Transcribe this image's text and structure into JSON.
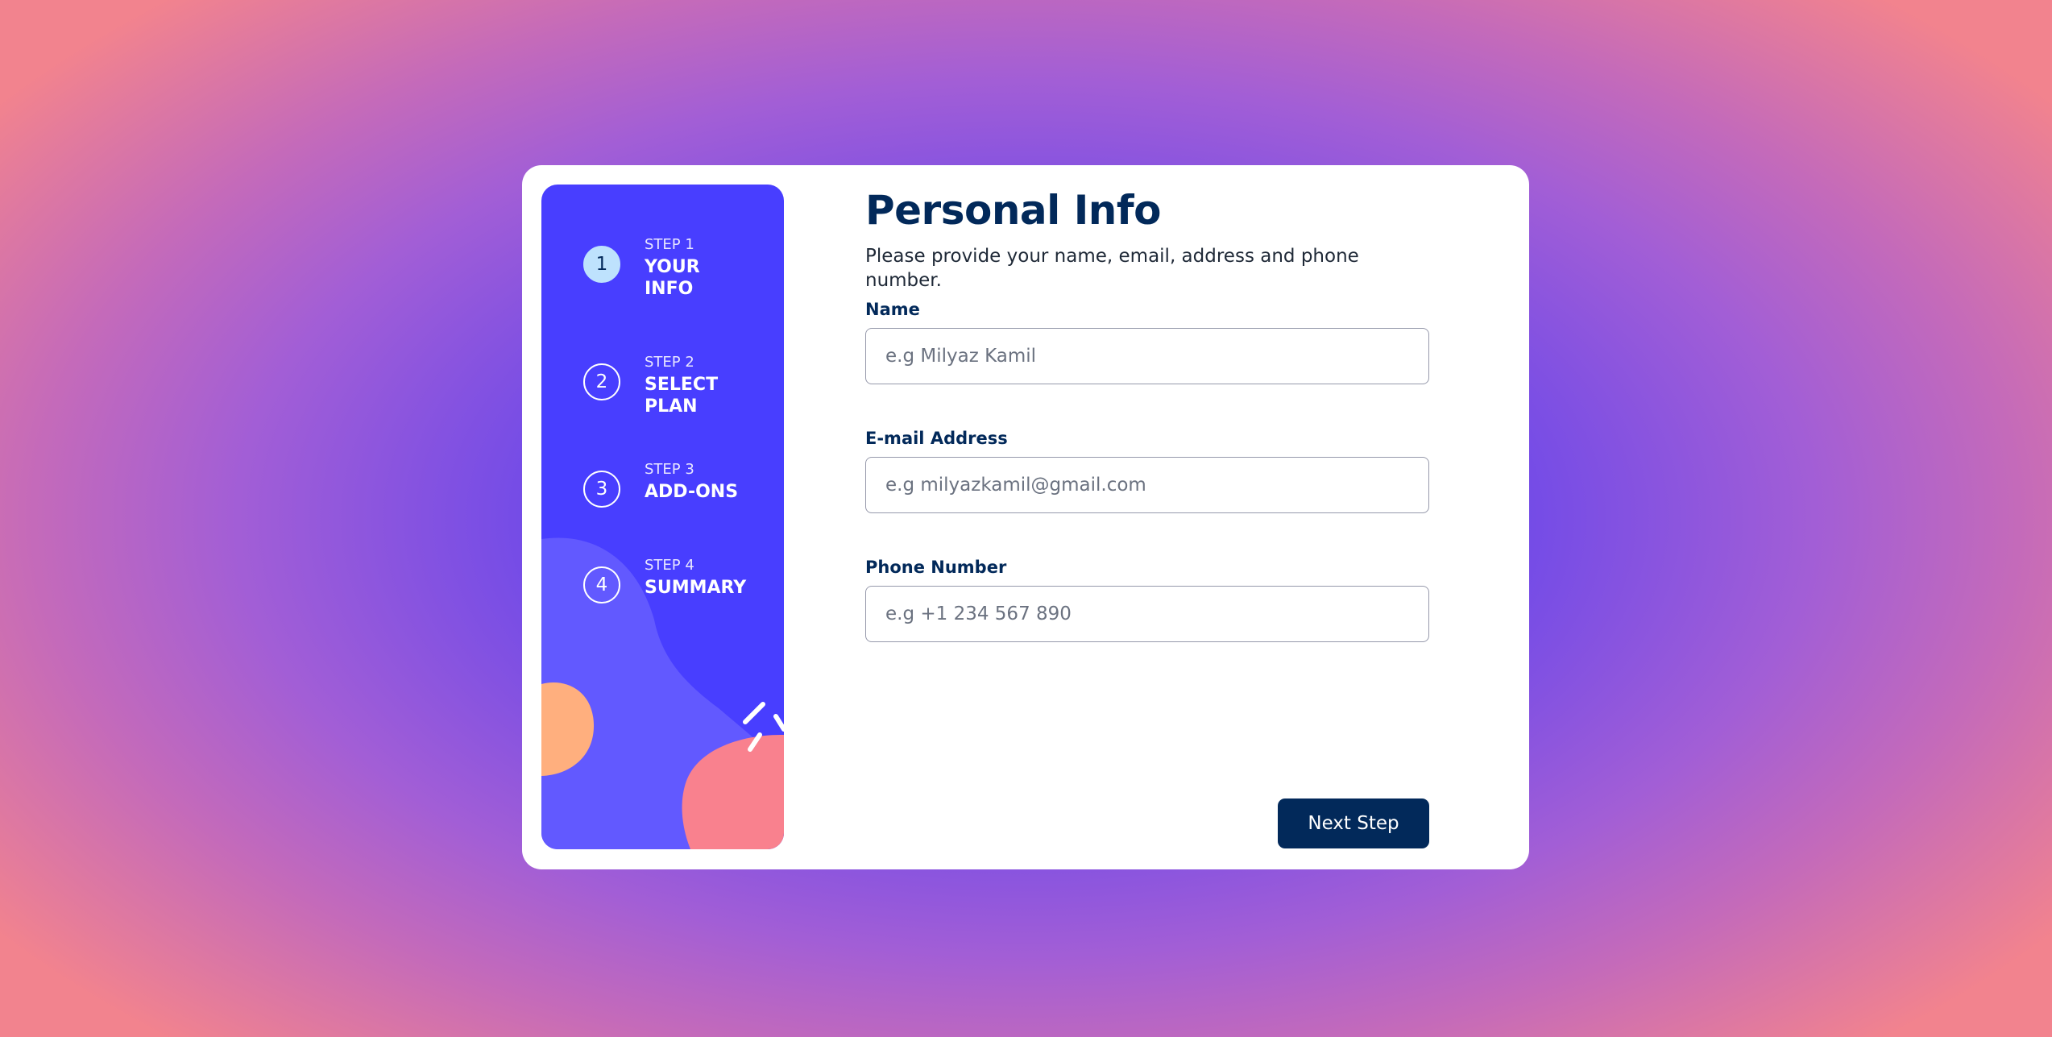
{
  "sidebar": {
    "steps": [
      {
        "number": "1",
        "label": "STEP 1",
        "title_line1": "YOUR",
        "title_line2": "INFO",
        "active": true
      },
      {
        "number": "2",
        "label": "STEP 2",
        "title_line1": "SELECT",
        "title_line2": "PLAN",
        "active": false
      },
      {
        "number": "3",
        "label": "STEP 3",
        "title_line1": "ADD-ONS",
        "title_line2": "",
        "active": false
      },
      {
        "number": "4",
        "label": "STEP 4",
        "title_line1": "SUMMARY",
        "title_line2": "",
        "active": false
      }
    ]
  },
  "main": {
    "title": "Personal Info",
    "subtitle": "Please provide your name, email, address and phone number.",
    "fields": {
      "name": {
        "label": "Name",
        "placeholder": "e.g Milyaz Kamil",
        "value": ""
      },
      "email": {
        "label": "E-mail Address",
        "placeholder": "e.g milyazkamil@gmail.com",
        "value": ""
      },
      "phone": {
        "label": "Phone Number",
        "placeholder": "e.g +1 234 567 890",
        "value": ""
      }
    },
    "next_label": "Next Step"
  },
  "colors": {
    "sidebar_bg": "#483eff",
    "active_step": "#bee2fd",
    "primary_text": "#02295a",
    "button_bg": "#02295a",
    "blob_orange": "#ffaf7e",
    "blob_pink": "#f9818e",
    "blob_violet": "#6259ff"
  }
}
